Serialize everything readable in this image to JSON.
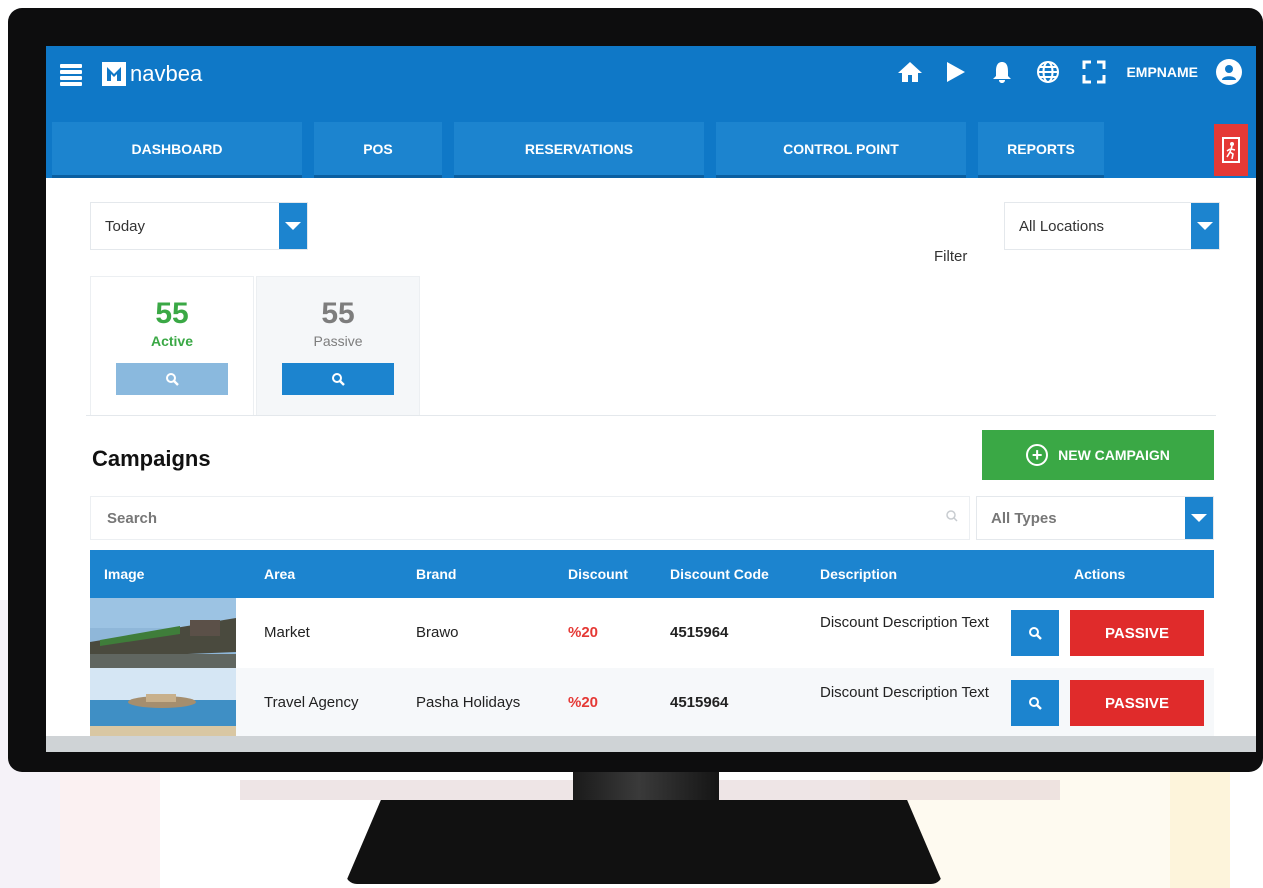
{
  "app": {
    "logo_text": "navbea",
    "user_name": "EMPNAME"
  },
  "topbar_icons": [
    "home-icon",
    "play-icon",
    "bell-icon",
    "globe-icon",
    "fullscreen-icon",
    "user-icon"
  ],
  "nav": {
    "tabs": [
      {
        "label": "DASHBOARD"
      },
      {
        "label": "POS"
      },
      {
        "label": "RESERVATIONS"
      },
      {
        "label": "CONTROL POINT"
      },
      {
        "label": "REPORTS"
      }
    ]
  },
  "filters": {
    "date_value": "Today",
    "filter_label": "Filter",
    "location_value": "All Locations"
  },
  "stats": {
    "active": {
      "count": "55",
      "label": "Active"
    },
    "passive": {
      "count": "55",
      "label": "Passive"
    }
  },
  "campaigns": {
    "title": "Campaigns",
    "new_button": "NEW CAMPAIGN",
    "search_placeholder": "Search",
    "type_value": "All Types"
  },
  "table": {
    "headers": {
      "image": "Image",
      "area": "Area",
      "brand": "Brand",
      "discount": "Discount",
      "discount_code": "Discount Code",
      "description": "Description",
      "actions": "Actions"
    },
    "rows": [
      {
        "area": "Market",
        "brand": "Brawo",
        "discount": "%20",
        "code": "4515964",
        "description": "Discount Description Text",
        "status_button": "PASSIVE"
      },
      {
        "area": "Travel Agency",
        "brand": "Pasha Holidays",
        "discount": "%20",
        "code": "4515964",
        "description": "Discount Description Text",
        "status_button": "PASSIVE"
      }
    ]
  },
  "colors": {
    "primary": "#1c84cf",
    "topbar": "#0f78c7",
    "active_green": "#3aa845",
    "danger_red": "#e02b2b",
    "passive_gray": "#888888"
  }
}
